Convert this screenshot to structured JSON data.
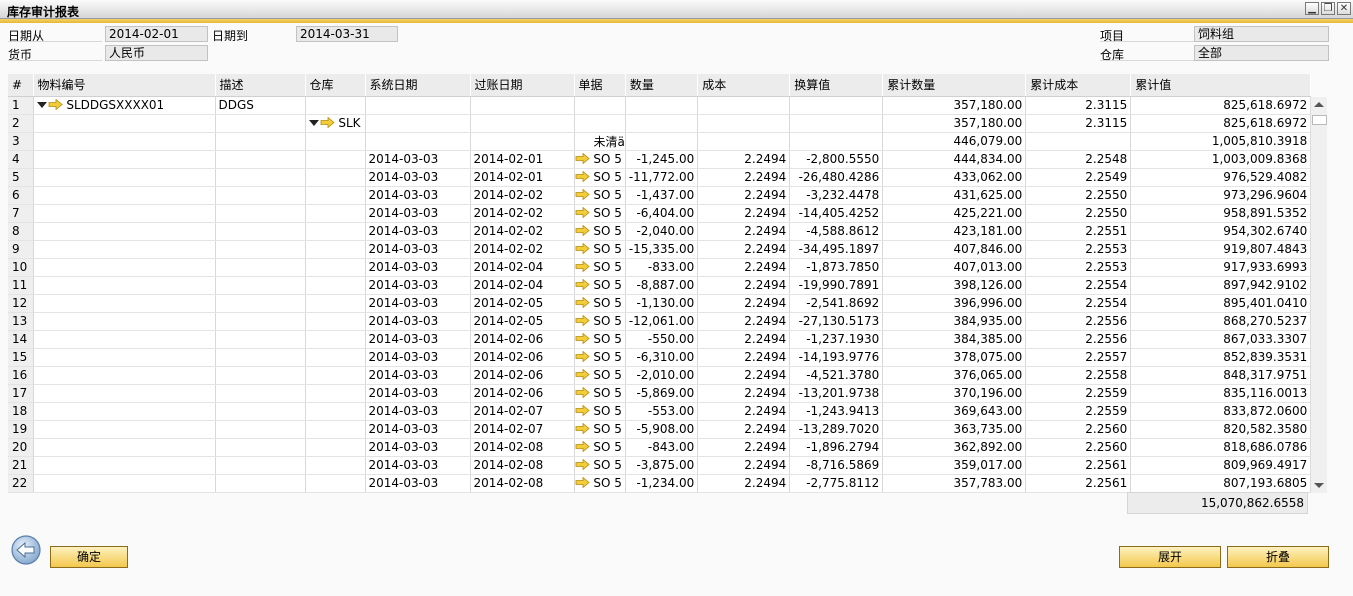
{
  "window": {
    "title": "库存审计报表"
  },
  "filters": {
    "date_from_label": "日期从",
    "date_from": "2014-02-01",
    "date_to_label": "日期到",
    "date_to": "2014-03-31",
    "currency_label": "货币",
    "currency": "人民币",
    "item_label": "项目",
    "item": "饲料组",
    "warehouse_label": "仓库",
    "warehouse": "全部"
  },
  "table": {
    "columns": [
      "#",
      "物料编号",
      "描述",
      "仓库",
      "系统日期",
      "过账日期",
      "单据",
      "数量",
      "成本",
      "换算值",
      "累计数量",
      "累计成本",
      "累计值"
    ],
    "rows": [
      {
        "n": "1",
        "item": "SLDDGSXXXX01",
        "desc": "DDGS",
        "wh": "",
        "sys": "",
        "post": "",
        "doc": "",
        "qty": "",
        "cost": "",
        "conv": "",
        "cqty": "357,180.00",
        "ccost": "2.3115",
        "cval": "825,618.6972"
      },
      {
        "n": "2",
        "item": "",
        "desc": "",
        "wh": "SLK",
        "sys": "",
        "post": "",
        "doc": "",
        "qty": "",
        "cost": "",
        "conv": "",
        "cqty": "357,180.00",
        "ccost": "2.3115",
        "cval": "825,618.6972"
      },
      {
        "n": "3",
        "item": "",
        "desc": "",
        "wh": "",
        "sys": "",
        "post": "",
        "doc": "未清ä",
        "qty": "",
        "cost": "",
        "conv": "",
        "cqty": "446,079.00",
        "ccost": "",
        "cval": "1,005,810.3918"
      },
      {
        "n": "4",
        "item": "",
        "desc": "",
        "wh": "",
        "sys": "2014-03-03",
        "post": "2014-02-01",
        "doc": "SO 5",
        "qty": "-1,245.00",
        "cost": "2.2494",
        "conv": "-2,800.5550",
        "cqty": "444,834.00",
        "ccost": "2.2548",
        "cval": "1,003,009.8368"
      },
      {
        "n": "5",
        "item": "",
        "desc": "",
        "wh": "",
        "sys": "2014-03-03",
        "post": "2014-02-01",
        "doc": "SO 5",
        "qty": "-11,772.00",
        "cost": "2.2494",
        "conv": "-26,480.4286",
        "cqty": "433,062.00",
        "ccost": "2.2549",
        "cval": "976,529.4082"
      },
      {
        "n": "6",
        "item": "",
        "desc": "",
        "wh": "",
        "sys": "2014-03-03",
        "post": "2014-02-02",
        "doc": "SO 5",
        "qty": "-1,437.00",
        "cost": "2.2494",
        "conv": "-3,232.4478",
        "cqty": "431,625.00",
        "ccost": "2.2550",
        "cval": "973,296.9604"
      },
      {
        "n": "7",
        "item": "",
        "desc": "",
        "wh": "",
        "sys": "2014-03-03",
        "post": "2014-02-02",
        "doc": "SO 5",
        "qty": "-6,404.00",
        "cost": "2.2494",
        "conv": "-14,405.4252",
        "cqty": "425,221.00",
        "ccost": "2.2550",
        "cval": "958,891.5352"
      },
      {
        "n": "8",
        "item": "",
        "desc": "",
        "wh": "",
        "sys": "2014-03-03",
        "post": "2014-02-02",
        "doc": "SO 5",
        "qty": "-2,040.00",
        "cost": "2.2494",
        "conv": "-4,588.8612",
        "cqty": "423,181.00",
        "ccost": "2.2551",
        "cval": "954,302.6740"
      },
      {
        "n": "9",
        "item": "",
        "desc": "",
        "wh": "",
        "sys": "2014-03-03",
        "post": "2014-02-02",
        "doc": "SO 5",
        "qty": "-15,335.00",
        "cost": "2.2494",
        "conv": "-34,495.1897",
        "cqty": "407,846.00",
        "ccost": "2.2553",
        "cval": "919,807.4843"
      },
      {
        "n": "10",
        "item": "",
        "desc": "",
        "wh": "",
        "sys": "2014-03-03",
        "post": "2014-02-04",
        "doc": "SO 5",
        "qty": "-833.00",
        "cost": "2.2494",
        "conv": "-1,873.7850",
        "cqty": "407,013.00",
        "ccost": "2.2553",
        "cval": "917,933.6993"
      },
      {
        "n": "11",
        "item": "",
        "desc": "",
        "wh": "",
        "sys": "2014-03-03",
        "post": "2014-02-04",
        "doc": "SO 5",
        "qty": "-8,887.00",
        "cost": "2.2494",
        "conv": "-19,990.7891",
        "cqty": "398,126.00",
        "ccost": "2.2554",
        "cval": "897,942.9102"
      },
      {
        "n": "12",
        "item": "",
        "desc": "",
        "wh": "",
        "sys": "2014-03-03",
        "post": "2014-02-05",
        "doc": "SO 5",
        "qty": "-1,130.00",
        "cost": "2.2494",
        "conv": "-2,541.8692",
        "cqty": "396,996.00",
        "ccost": "2.2554",
        "cval": "895,401.0410"
      },
      {
        "n": "13",
        "item": "",
        "desc": "",
        "wh": "",
        "sys": "2014-03-03",
        "post": "2014-02-05",
        "doc": "SO 5",
        "qty": "-12,061.00",
        "cost": "2.2494",
        "conv": "-27,130.5173",
        "cqty": "384,935.00",
        "ccost": "2.2556",
        "cval": "868,270.5237"
      },
      {
        "n": "14",
        "item": "",
        "desc": "",
        "wh": "",
        "sys": "2014-03-03",
        "post": "2014-02-06",
        "doc": "SO 5",
        "qty": "-550.00",
        "cost": "2.2494",
        "conv": "-1,237.1930",
        "cqty": "384,385.00",
        "ccost": "2.2556",
        "cval": "867,033.3307"
      },
      {
        "n": "15",
        "item": "",
        "desc": "",
        "wh": "",
        "sys": "2014-03-03",
        "post": "2014-02-06",
        "doc": "SO 5",
        "qty": "-6,310.00",
        "cost": "2.2494",
        "conv": "-14,193.9776",
        "cqty": "378,075.00",
        "ccost": "2.2557",
        "cval": "852,839.3531"
      },
      {
        "n": "16",
        "item": "",
        "desc": "",
        "wh": "",
        "sys": "2014-03-03",
        "post": "2014-02-06",
        "doc": "SO 5",
        "qty": "-2,010.00",
        "cost": "2.2494",
        "conv": "-4,521.3780",
        "cqty": "376,065.00",
        "ccost": "2.2558",
        "cval": "848,317.9751"
      },
      {
        "n": "17",
        "item": "",
        "desc": "",
        "wh": "",
        "sys": "2014-03-03",
        "post": "2014-02-06",
        "doc": "SO 5",
        "qty": "-5,869.00",
        "cost": "2.2494",
        "conv": "-13,201.9738",
        "cqty": "370,196.00",
        "ccost": "2.2559",
        "cval": "835,116.0013"
      },
      {
        "n": "18",
        "item": "",
        "desc": "",
        "wh": "",
        "sys": "2014-03-03",
        "post": "2014-02-07",
        "doc": "SO 5",
        "qty": "-553.00",
        "cost": "2.2494",
        "conv": "-1,243.9413",
        "cqty": "369,643.00",
        "ccost": "2.2559",
        "cval": "833,872.0600"
      },
      {
        "n": "19",
        "item": "",
        "desc": "",
        "wh": "",
        "sys": "2014-03-03",
        "post": "2014-02-07",
        "doc": "SO 5",
        "qty": "-5,908.00",
        "cost": "2.2494",
        "conv": "-13,289.7020",
        "cqty": "363,735.00",
        "ccost": "2.2560",
        "cval": "820,582.3580"
      },
      {
        "n": "20",
        "item": "",
        "desc": "",
        "wh": "",
        "sys": "2014-03-03",
        "post": "2014-02-08",
        "doc": "SO 5",
        "qty": "-843.00",
        "cost": "2.2494",
        "conv": "-1,896.2794",
        "cqty": "362,892.00",
        "ccost": "2.2560",
        "cval": "818,686.0786"
      },
      {
        "n": "21",
        "item": "",
        "desc": "",
        "wh": "",
        "sys": "2014-03-03",
        "post": "2014-02-08",
        "doc": "SO 5",
        "qty": "-3,875.00",
        "cost": "2.2494",
        "conv": "-8,716.5869",
        "cqty": "359,017.00",
        "ccost": "2.2561",
        "cval": "809,969.4917"
      },
      {
        "n": "22",
        "item": "",
        "desc": "",
        "wh": "",
        "sys": "2014-03-03",
        "post": "2014-02-08",
        "doc": "SO 5",
        "qty": "-1,234.00",
        "cost": "2.2494",
        "conv": "-2,775.8112",
        "cqty": "357,783.00",
        "ccost": "2.2561",
        "cval": "807,193.6805"
      }
    ],
    "total_value": "15,070,862.6558"
  },
  "buttons": {
    "ok": "确定",
    "expand": "展开",
    "collapse": "折叠"
  },
  "icons": {
    "back": "back-arrow-icon",
    "link": "link-arrow-icon"
  },
  "colors": {
    "accent": "#f4c84c",
    "header_bg": "#ececec"
  }
}
